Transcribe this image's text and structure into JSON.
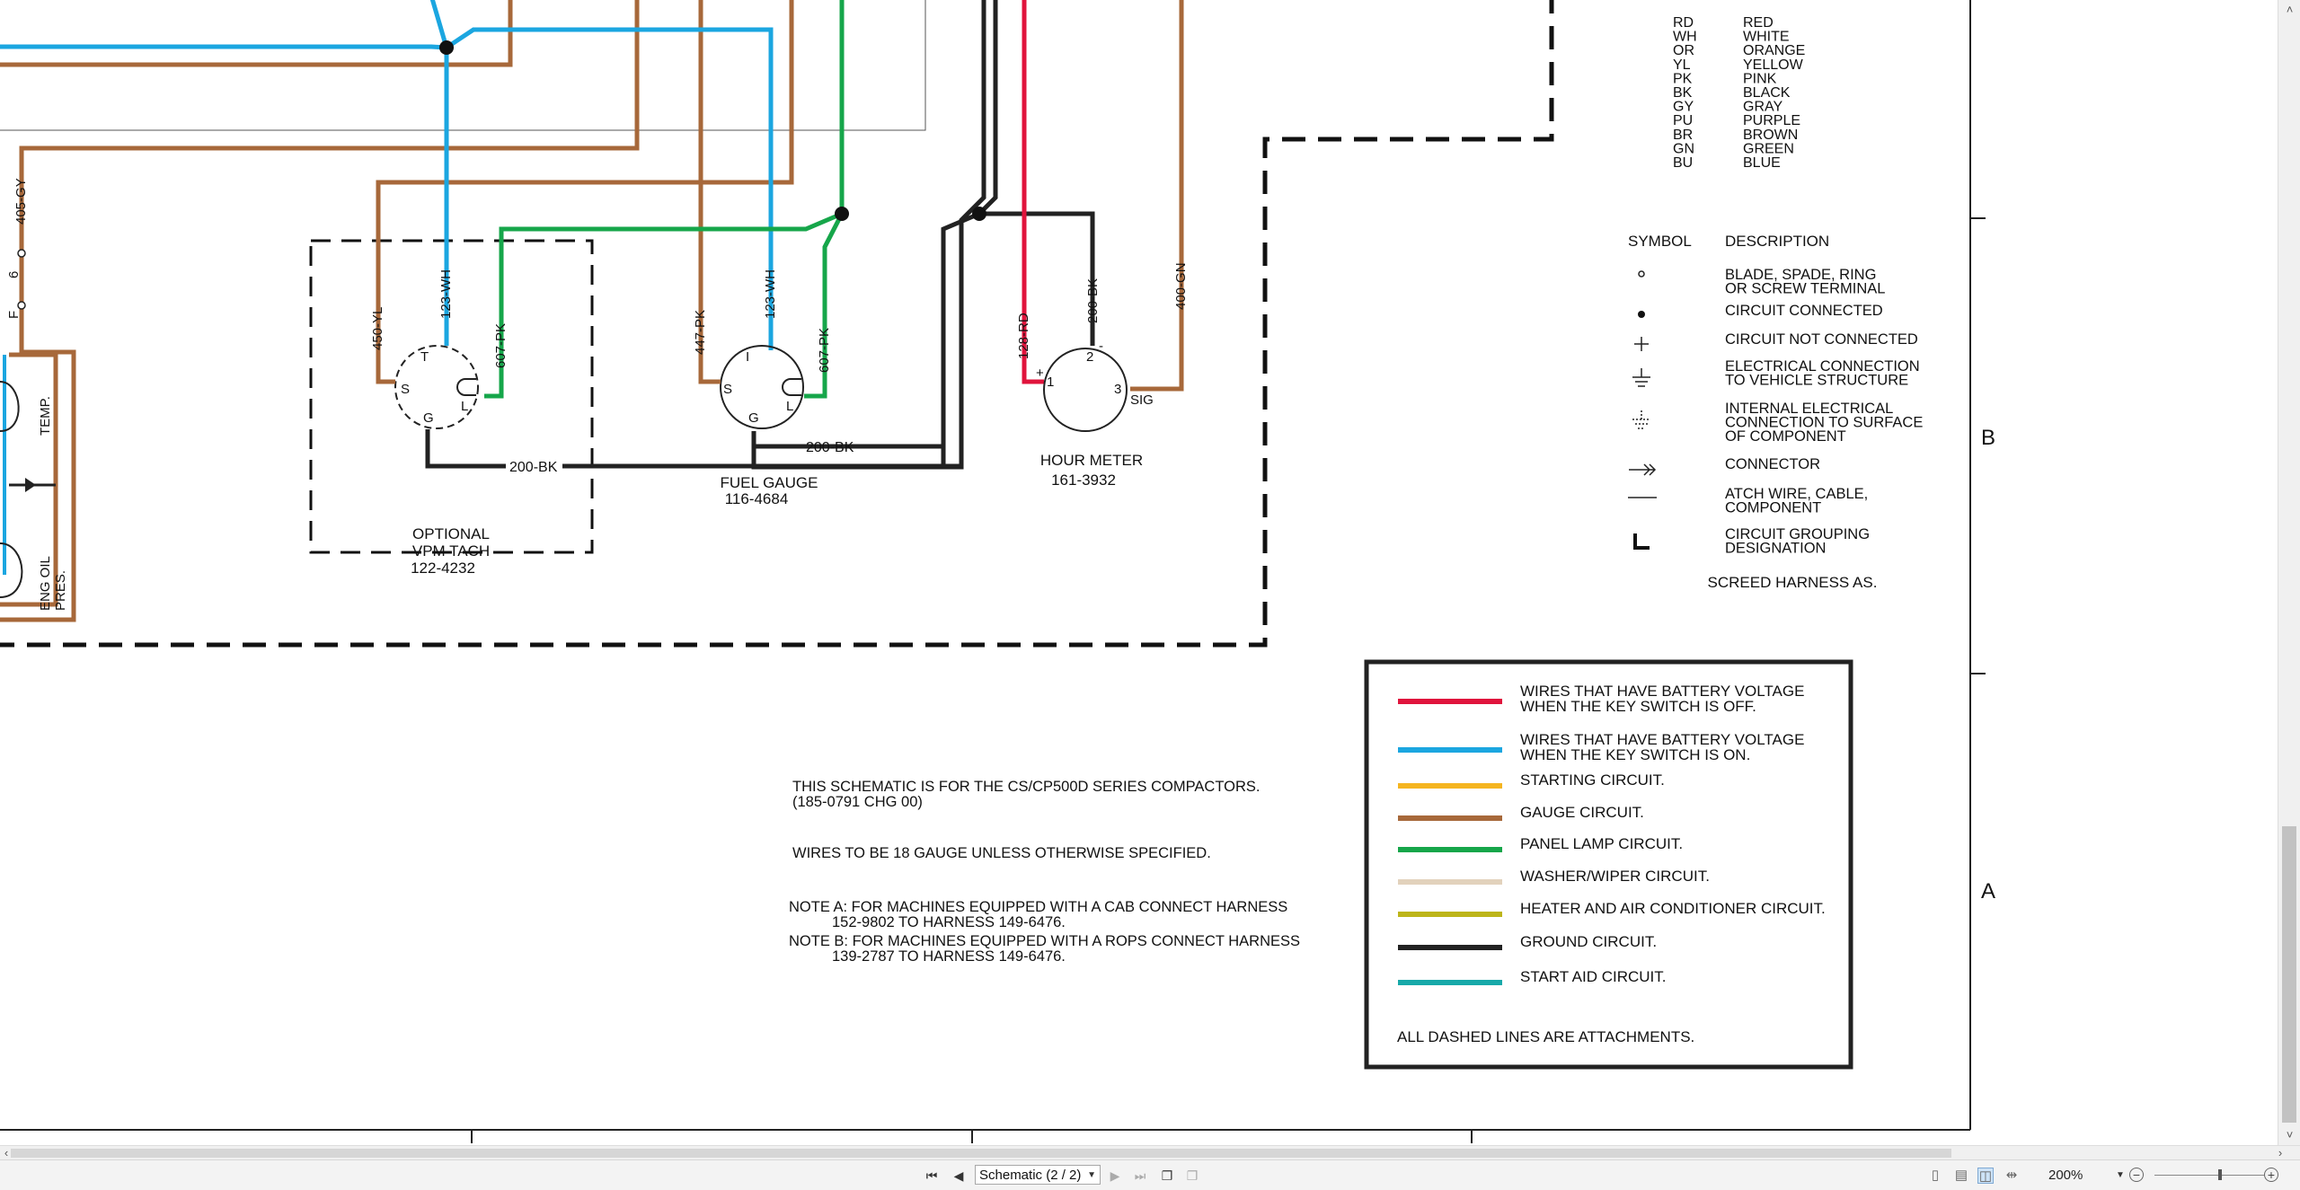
{
  "schematic": {
    "wire_colors": {
      "red": "#e0143c",
      "blue": "#1ba6e0",
      "orange": "#f5b520",
      "brown": "#a7683a",
      "green": "#16a64a",
      "beige": "#e2d2bc",
      "olive": "#bdb51a",
      "black": "#222222",
      "teal": "#17a9a9"
    },
    "components": {
      "left": {
        "wire_405gy": "405-GY",
        "term_6": "6",
        "term_f": "F",
        "temp": "TEMP.",
        "eng_oil_1": "ENG OIL",
        "eng_oil_2": "PRES."
      },
      "tach": {
        "name1": "OPTIONAL",
        "name2": "VPM TACH",
        "part": "122-4232",
        "wire_450yl": "450-YL",
        "wire_123wh": "123-WH",
        "wire_607pk": "607-PK",
        "term_t": "T",
        "term_s": "S",
        "term_l": "L",
        "term_g": "G",
        "wire_200bk": "200-BK"
      },
      "fuel_gauge": {
        "name": "FUEL GAUGE",
        "part": "116-4684",
        "wire_447pk": "447-PK",
        "wire_123wh": "123-WH",
        "wire_607pk": "607-PK",
        "term_i": "I",
        "term_s": "S",
        "term_l": "L",
        "term_g": "G",
        "wire_200bk": "200-BK"
      },
      "hour_meter": {
        "name": "HOUR METER",
        "part": "161-3932",
        "wire_128rd": "128-RD",
        "wire_200bk": "200-BK",
        "wire_400gn": "400-GN",
        "term_plus": "+",
        "term_1": "1",
        "term_2": "2",
        "term_minus": "-",
        "term_3": "3",
        "term_sig": "SIG"
      }
    },
    "color_codes": [
      {
        "code": "RD",
        "name": "RED"
      },
      {
        "code": "WH",
        "name": "WHITE"
      },
      {
        "code": "OR",
        "name": "ORANGE"
      },
      {
        "code": "YL",
        "name": "YELLOW"
      },
      {
        "code": "PK",
        "name": "PINK"
      },
      {
        "code": "BK",
        "name": "BLACK"
      },
      {
        "code": "GY",
        "name": "GRAY"
      },
      {
        "code": "PU",
        "name": "PURPLE"
      },
      {
        "code": "BR",
        "name": "BROWN"
      },
      {
        "code": "GN",
        "name": "GREEN"
      },
      {
        "code": "BU",
        "name": "BLUE"
      }
    ],
    "symbol_table": {
      "col_symbol": "SYMBOL",
      "col_description": "DESCRIPTION",
      "rows": [
        {
          "lines": [
            "BLADE, SPADE, RING",
            "OR SCREW TERMINAL"
          ]
        },
        {
          "lines": [
            "CIRCUIT CONNECTED"
          ]
        },
        {
          "lines": [
            "CIRCUIT NOT CONNECTED"
          ]
        },
        {
          "lines": [
            "ELECTRICAL CONNECTION",
            "TO VEHICLE STRUCTURE"
          ]
        },
        {
          "lines": [
            "INTERNAL ELECTRICAL",
            "CONNECTION TO SURFACE",
            "OF COMPONENT"
          ]
        },
        {
          "lines": [
            "CONNECTOR"
          ]
        },
        {
          "lines": [
            "ATCH WIRE, CABLE,",
            "COMPONENT"
          ]
        },
        {
          "lines": [
            "CIRCUIT GROUPING",
            "DESIGNATION"
          ]
        }
      ],
      "footer": "SCREED HARNESS AS."
    },
    "zone_labels": {
      "b": "B",
      "a": "A"
    },
    "notes": {
      "line1": "THIS SCHEMATIC IS FOR THE CS/CP500D SERIES COMPACTORS.",
      "line2": "(185-0791 CHG 00)",
      "line3": "WIRES TO BE 18 GAUGE UNLESS OTHERWISE SPECIFIED.",
      "note_a1": "NOTE A: FOR MACHINES EQUIPPED WITH A CAB CONNECT HARNESS",
      "note_a2": "152-9802 TO HARNESS 149-6476.",
      "note_b1": "NOTE B: FOR MACHINES EQUIPPED WITH A ROPS CONNECT HARNESS",
      "note_b2": "139-2787 TO HARNESS 149-6476."
    },
    "legend": {
      "items": [
        {
          "color": "#e0143c",
          "lines": [
            "WIRES THAT HAVE BATTERY VOLTAGE",
            "WHEN THE KEY SWITCH IS OFF."
          ]
        },
        {
          "color": "#1ba6e0",
          "lines": [
            "WIRES THAT HAVE BATTERY VOLTAGE",
            "WHEN THE KEY SWITCH IS ON."
          ]
        },
        {
          "color": "#f5b520",
          "lines": [
            "STARTING CIRCUIT."
          ]
        },
        {
          "color": "#a7683a",
          "lines": [
            "GAUGE CIRCUIT."
          ]
        },
        {
          "color": "#16a64a",
          "lines": [
            "PANEL LAMP CIRCUIT."
          ]
        },
        {
          "color": "#e2d2bc",
          "lines": [
            "WASHER/WIPER CIRCUIT."
          ]
        },
        {
          "color": "#bdb51a",
          "lines": [
            "HEATER AND AIR CONDITIONER CIRCUIT."
          ]
        },
        {
          "color": "#222222",
          "lines": [
            "GROUND CIRCUIT."
          ]
        },
        {
          "color": "#17a9a9",
          "lines": [
            "START AID CIRCUIT."
          ]
        }
      ],
      "footer": "ALL DASHED LINES ARE ATTACHMENTS."
    }
  },
  "statusbar": {
    "page_select": "Schematic (2 / 2)",
    "zoom": "200%",
    "icons": {
      "first": "first-page-icon",
      "prev": "previous-page-icon",
      "next": "next-page-icon",
      "last": "last-page-icon",
      "copy": "copy-icon",
      "paste": "paste-icon"
    }
  }
}
